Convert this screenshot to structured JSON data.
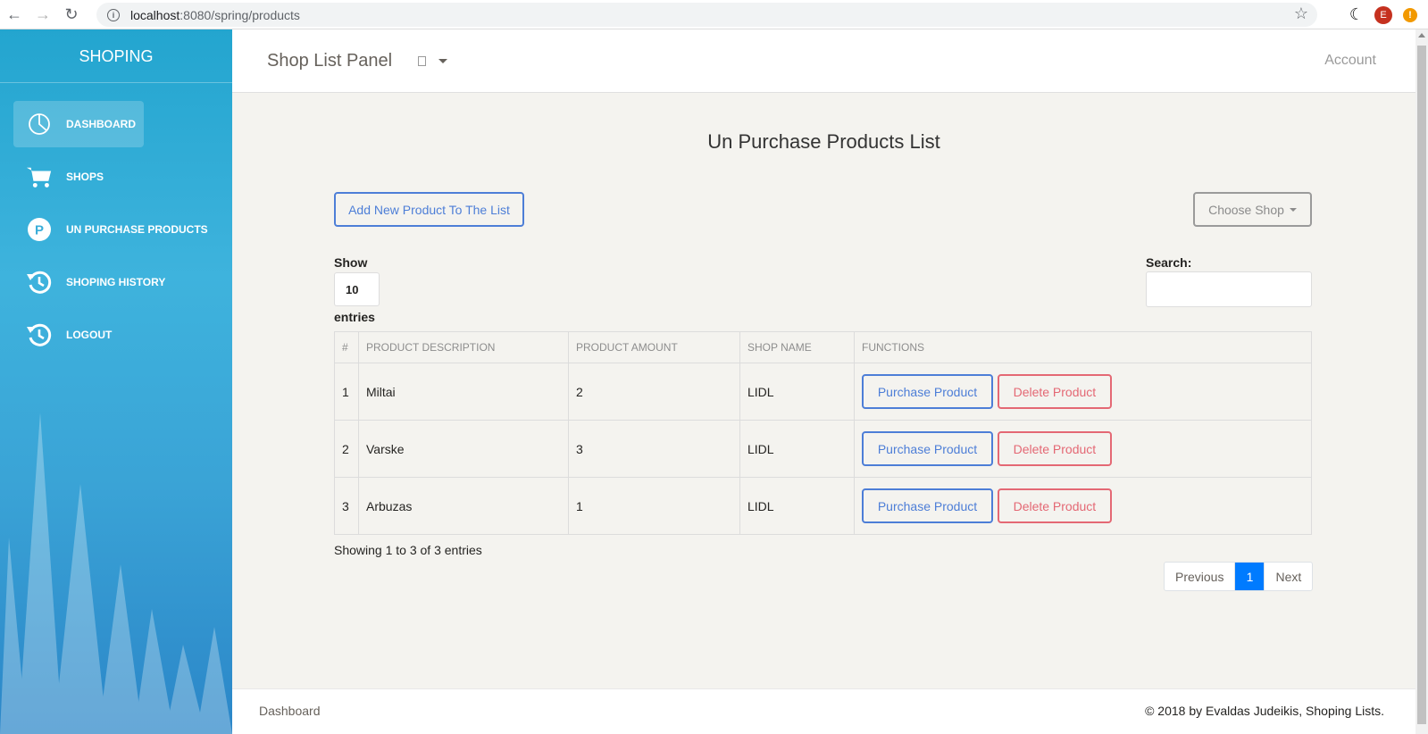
{
  "browser": {
    "url_host": "localhost",
    "url_path": ":8080/spring/products",
    "profile_initial": "E",
    "alert_symbol": "!"
  },
  "sidebar": {
    "brand": "SHOPING",
    "items": [
      {
        "label": "DASHBOARD",
        "icon": "pie-chart-icon",
        "active": true
      },
      {
        "label": "SHOPS",
        "icon": "cart-icon",
        "active": false
      },
      {
        "label": "UN PURCHASE PRODUCTS",
        "icon": "parking-icon",
        "active": false
      },
      {
        "label": "SHOPING HISTORY",
        "icon": "history-icon",
        "active": false
      },
      {
        "label": "LOGOUT",
        "icon": "history-icon",
        "active": false
      }
    ]
  },
  "topbar": {
    "title": "Shop List Panel",
    "account": "Account"
  },
  "main": {
    "title": "Un Purchase Products List",
    "add_button": "Add New Product To The List",
    "choose_shop": "Choose Shop",
    "show_label": "Show",
    "length_value": "10",
    "entries_label": "entries",
    "search_label": "Search:",
    "table": {
      "headers": [
        "#",
        "PRODUCT DESCRIPTION",
        "PRODUCT AMOUNT",
        "SHOP NAME",
        "FUNCTIONS"
      ],
      "rows": [
        {
          "num": "1",
          "description": "Miltai",
          "amount": "2",
          "shop": "LIDL"
        },
        {
          "num": "2",
          "description": "Varske",
          "amount": "3",
          "shop": "LIDL"
        },
        {
          "num": "3",
          "description": "Arbuzas",
          "amount": "1",
          "shop": "LIDL"
        }
      ],
      "purchase_label": "Purchase Product",
      "delete_label": "Delete Product"
    },
    "info": "Showing 1 to 3 of 3 entries",
    "pagination": {
      "previous": "Previous",
      "current": "1",
      "next": "Next"
    }
  },
  "footer": {
    "left": "Dashboard",
    "right": "© 2018 by Evaldas Judeikis, Shoping Lists."
  },
  "colors": {
    "primary_blue": "#4d7ed7",
    "danger_red": "#e46874",
    "active_page": "#007bff",
    "sidebar_top": "#23a5cf"
  }
}
